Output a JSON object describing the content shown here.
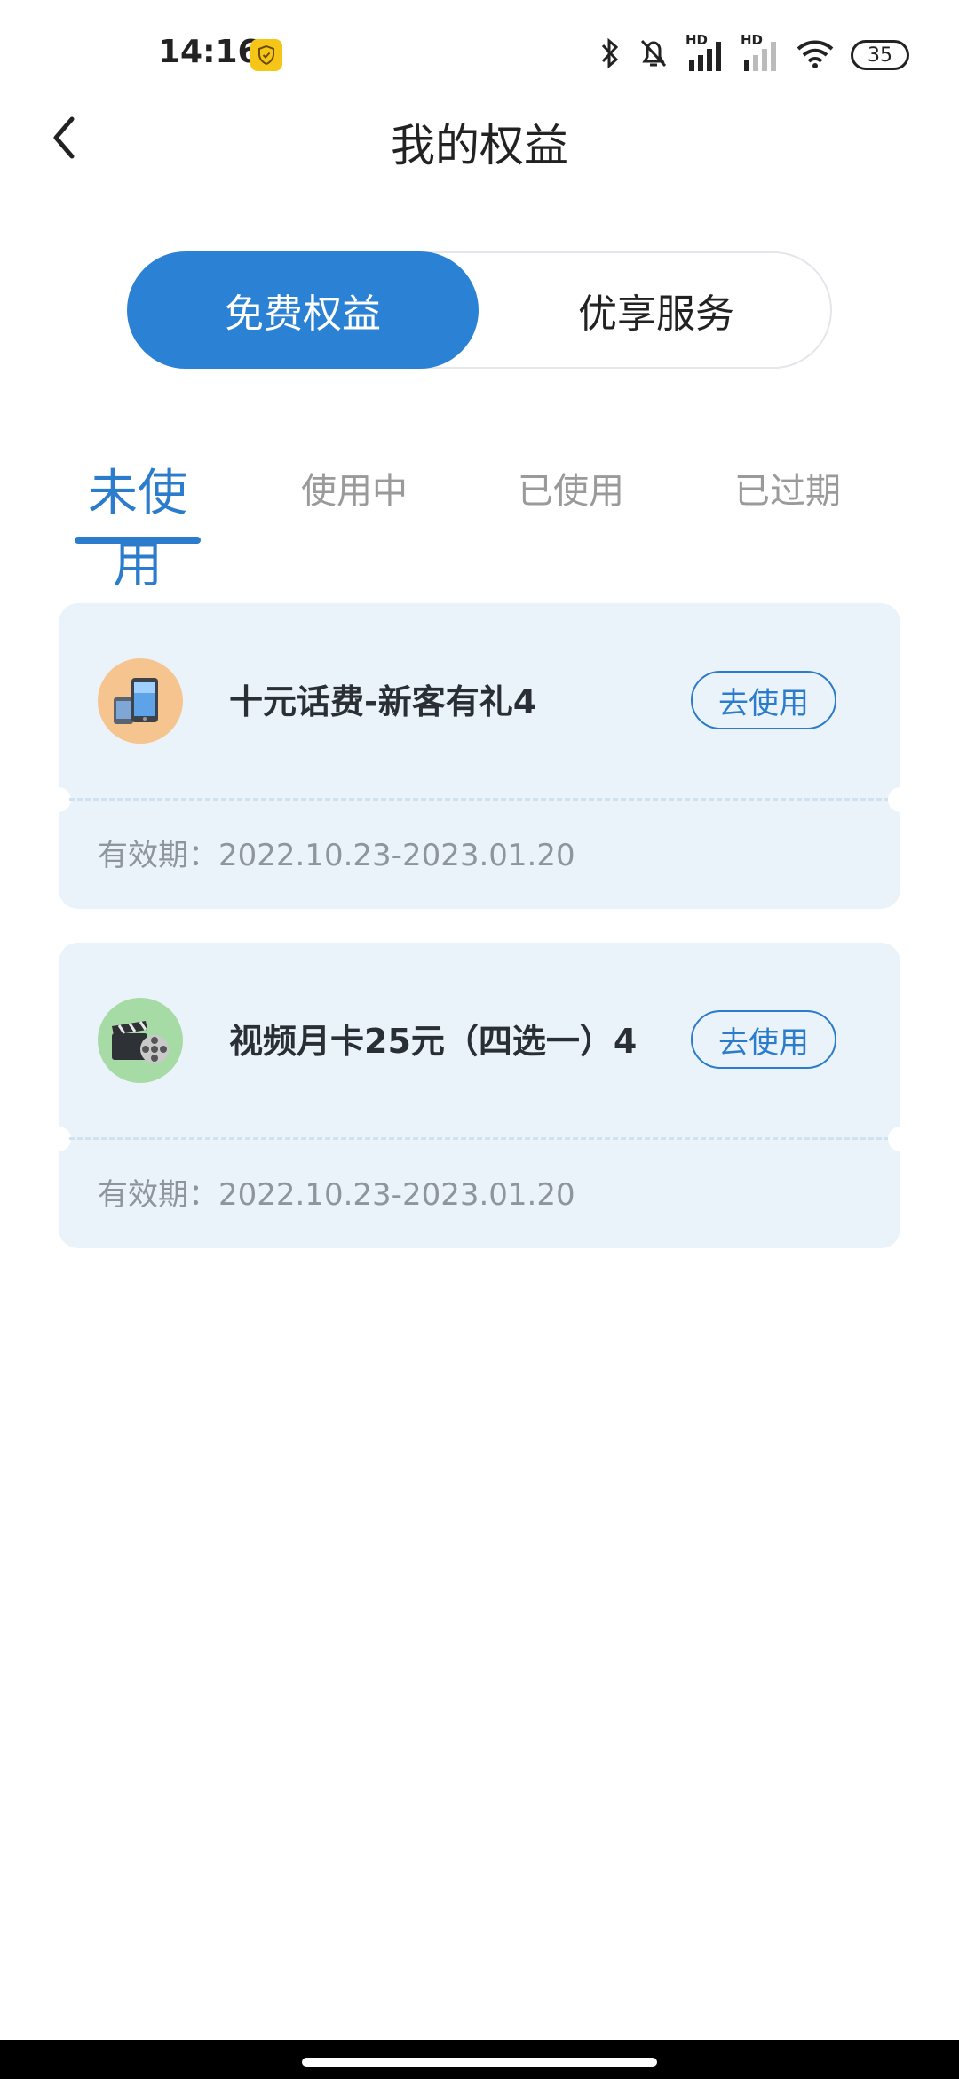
{
  "status_bar": {
    "time": "14:16",
    "battery": "35",
    "hd1": "HD",
    "hd2": "HD"
  },
  "header": {
    "title": "我的权益"
  },
  "segments": {
    "left": "免费权益",
    "right": "优享服务",
    "active": "left"
  },
  "subtabs": {
    "items": [
      "未使用",
      "使用中",
      "已使用",
      "已过期"
    ],
    "active": 0
  },
  "cards": [
    {
      "title": "十元话费-新客有礼4",
      "button": "去使用",
      "validity": "有效期：2022.10.23-2023.01.20",
      "icon": "phone-icon",
      "icon_bg": "#f6c48f"
    },
    {
      "title": "视频月卡25元（四选一）4",
      "button": "去使用",
      "validity": "有效期：2022.10.23-2023.01.20",
      "icon": "film-icon",
      "icon_bg": "#a7dba6"
    }
  ],
  "colors": {
    "accent": "#2b82d4",
    "card_bg": "#ebf3fa",
    "muted": "#9a9a9a"
  }
}
